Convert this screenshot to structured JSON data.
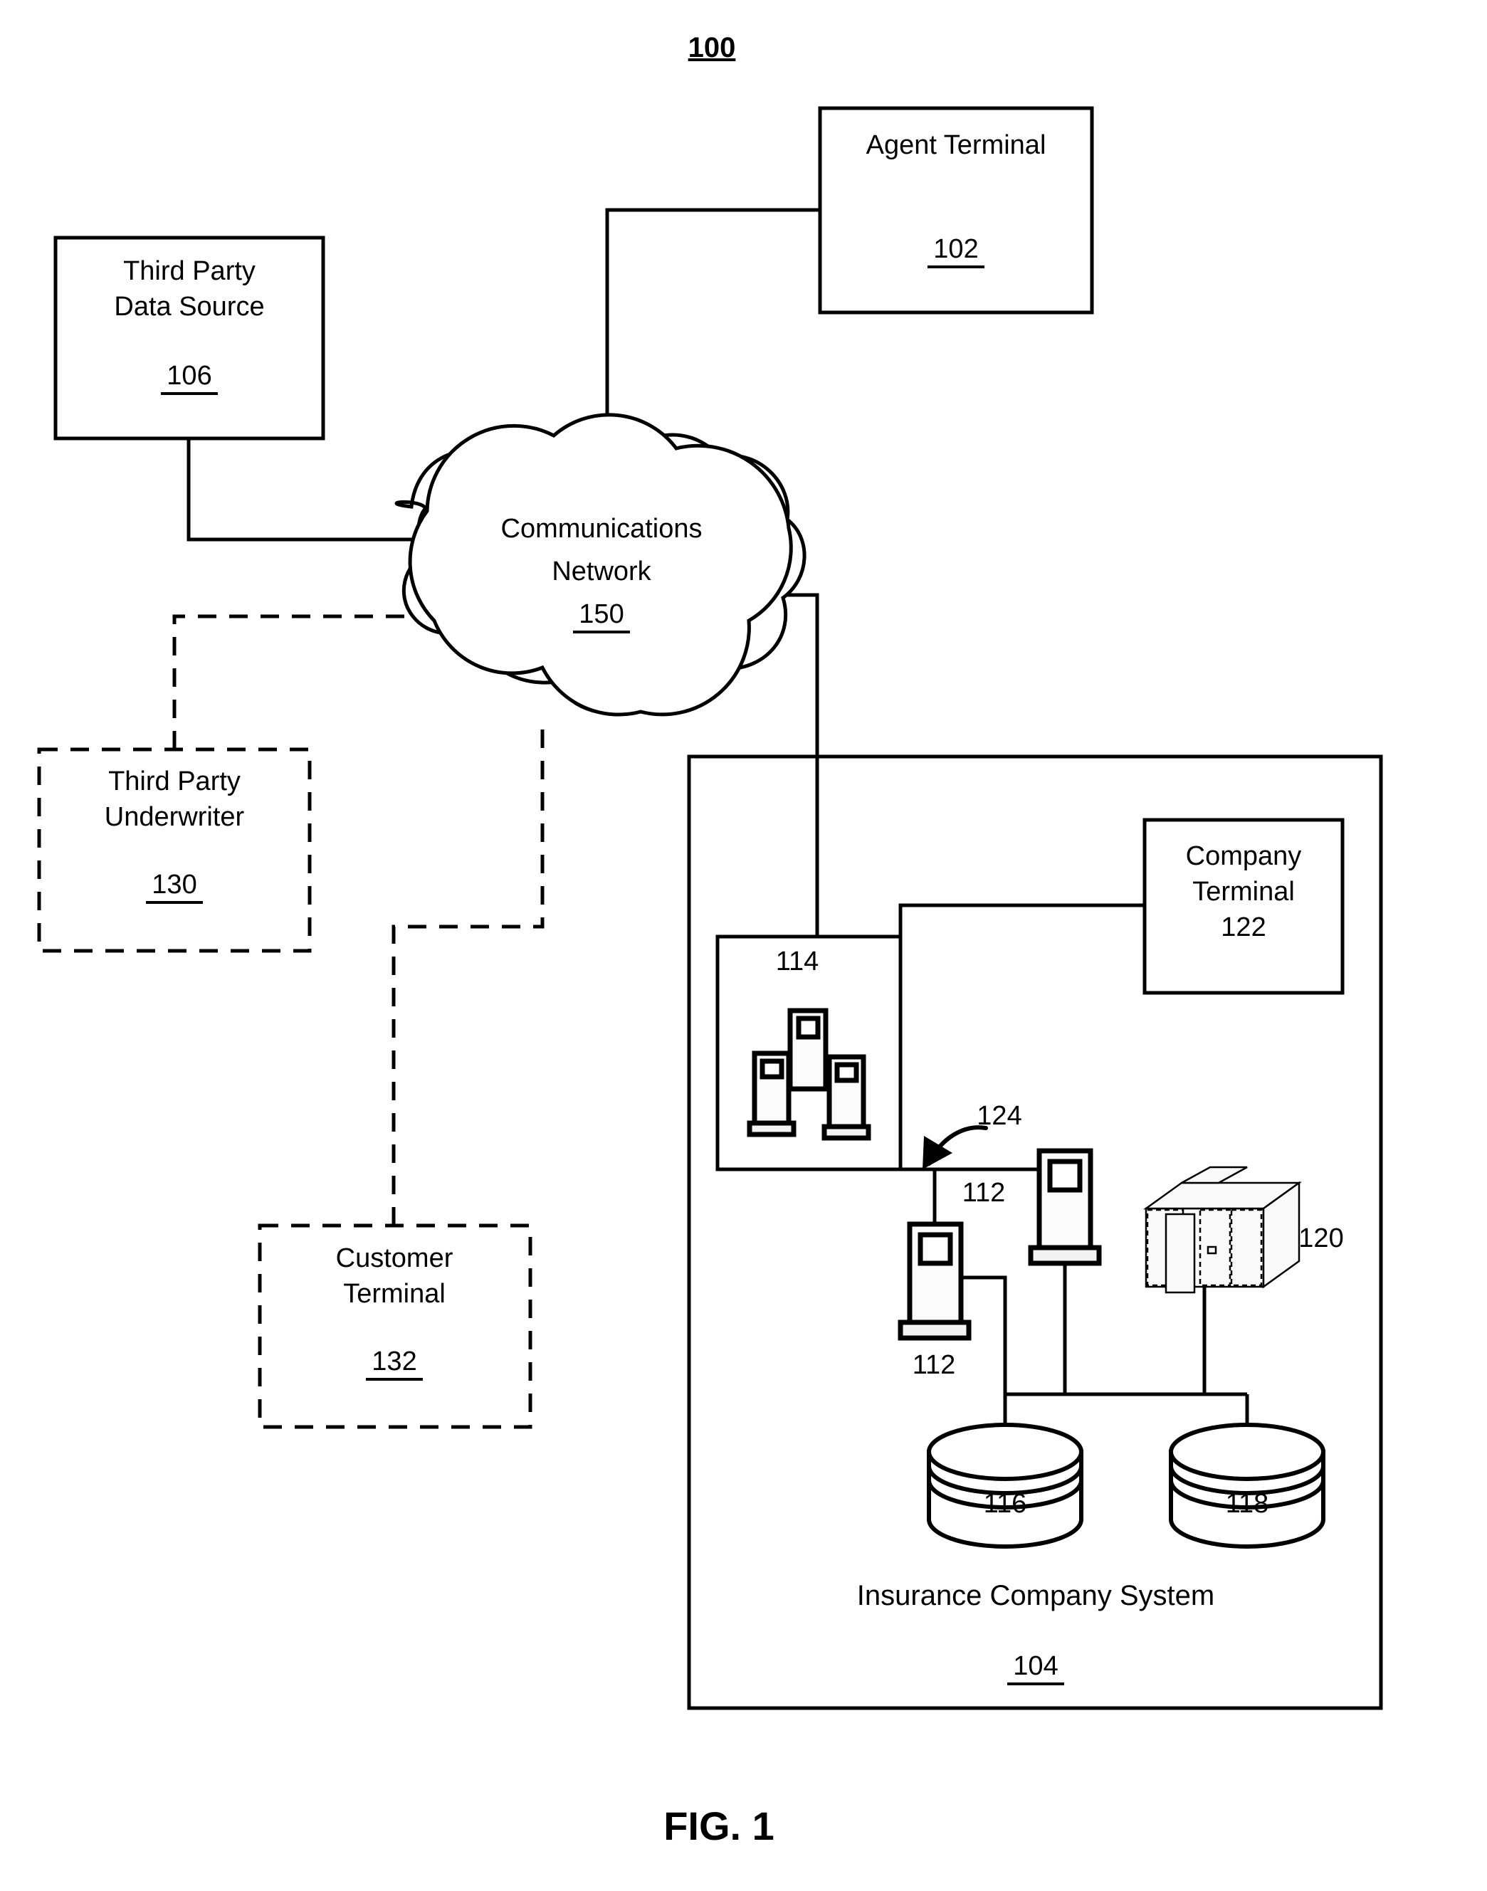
{
  "figure": {
    "system_number": "100",
    "caption": "FIG. 1"
  },
  "nodes": {
    "agent_terminal": {
      "label": "Agent Terminal",
      "ref": "102"
    },
    "third_party_data_source": {
      "label_line1": "Third Party",
      "label_line2": "Data Source",
      "ref": "106"
    },
    "communications_network": {
      "label_line1": "Communications",
      "label_line2": "Network",
      "ref": "150"
    },
    "third_party_underwriter": {
      "label_line1": "Third Party",
      "label_line2": "Underwriter",
      "ref": "130"
    },
    "customer_terminal": {
      "label_line1": "Customer",
      "label_line2": "Terminal",
      "ref": "132"
    },
    "insurance_company_system": {
      "label": "Insurance Company System",
      "ref": "104"
    },
    "company_terminal": {
      "label_line1": "Company",
      "label_line2": "Terminal",
      "ref": "122"
    },
    "server_cluster": {
      "ref": "114"
    },
    "server_left": {
      "ref": "112"
    },
    "server_right": {
      "ref": "112"
    },
    "network_bus": {
      "ref": "124"
    },
    "mainframe": {
      "ref": "120"
    },
    "database_left": {
      "ref": "116"
    },
    "database_right": {
      "ref": "118"
    }
  },
  "colors": {
    "stroke": "#000000",
    "background": "#ffffff",
    "icon_fill": "#fbfbfb"
  }
}
